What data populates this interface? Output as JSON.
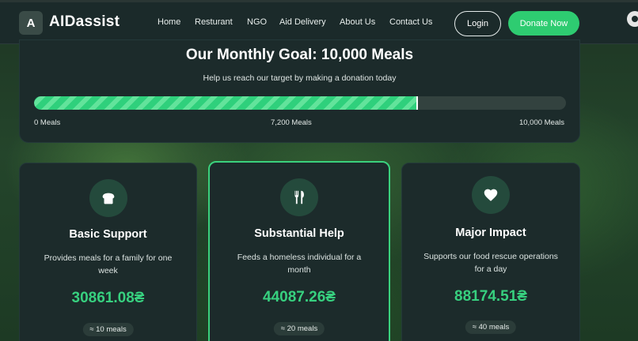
{
  "navbar": {
    "logo_letter": "A",
    "brand": "AIDassist",
    "links": [
      "Home",
      "Resturant",
      "NGO",
      "Aid Delivery",
      "About Us",
      "Contact Us"
    ],
    "login_label": "Login",
    "donate_label": "Donate Now",
    "settings_icon": "gear-icon"
  },
  "goal": {
    "title": "Our Monthly Goal: 10,000 Meals",
    "subtitle": "Help us reach our target by making a donation today",
    "progress": 0.72,
    "label_start": "0 Meals",
    "label_current": "7,200 Meals",
    "label_end": "10,000 Meals",
    "colors": {
      "fill": "#2fd07c",
      "track": "#33423f"
    }
  },
  "tiers": [
    {
      "icon": "bread-icon",
      "title": "Basic Support",
      "description": "Provides meals for a family for one week",
      "amount": "30861.08₴",
      "meals": "≈ 10 meals"
    },
    {
      "icon": "utensils-icon",
      "title": "Substantial Help",
      "description": "Feeds a homeless individual for a month",
      "amount": "44087.26₴",
      "meals": "≈ 20 meals",
      "highlighted": true
    },
    {
      "icon": "heart-icon",
      "title": "Major Impact",
      "description": "Supports our food rescue operations for a day",
      "amount": "88174.51₴",
      "meals": "≈ 40 meals"
    }
  ],
  "colors": {
    "accent": "#2ecc71",
    "card": "#1c2b2b",
    "amount": "#37d07f"
  }
}
